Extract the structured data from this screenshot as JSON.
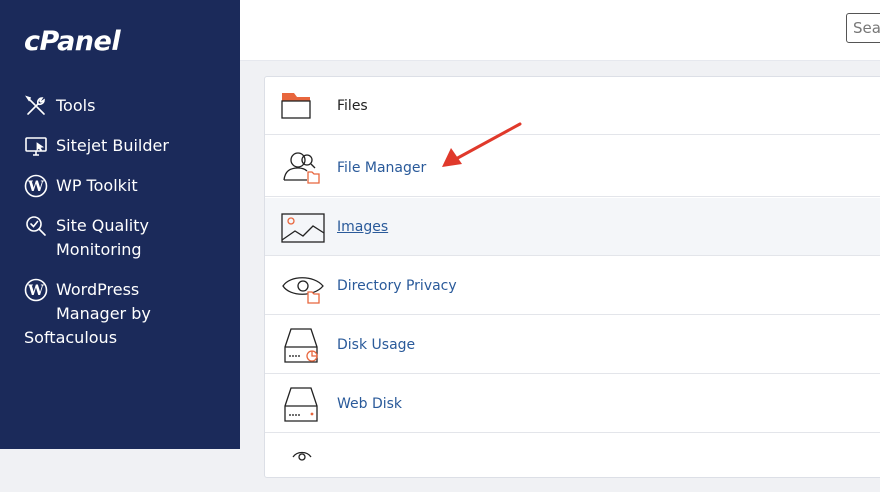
{
  "brand": {
    "logo_text": "cPanel"
  },
  "sidebar": {
    "items": [
      {
        "label": "Tools",
        "icon": "tools-icon"
      },
      {
        "label": "Sitejet Builder",
        "icon": "monitor-icon"
      },
      {
        "label": "WP Toolkit",
        "icon": "wordpress-icon"
      },
      {
        "label_lines": [
          "Site Quality",
          "Monitoring"
        ],
        "icon": "magnifier-check-icon"
      },
      {
        "label_lines": [
          "WordPress",
          "Manager by",
          "Softaculous"
        ],
        "icon": "wordpress-icon"
      }
    ]
  },
  "search": {
    "placeholder": "Search"
  },
  "files_section": {
    "title": "Files",
    "items": [
      {
        "label": "File Manager",
        "icon": "file-manager-icon"
      },
      {
        "label": "Images",
        "icon": "images-icon",
        "state": "hover"
      },
      {
        "label": "Directory Privacy",
        "icon": "eye-folder-icon"
      },
      {
        "label": "Disk Usage",
        "icon": "disk-usage-icon"
      },
      {
        "label": "Web Disk",
        "icon": "web-disk-icon"
      }
    ]
  },
  "colors": {
    "sidebar_bg": "#1b2a5a",
    "accent_orange": "#e8663d",
    "link_blue": "#2a5a9a",
    "annotation_red": "#e0392b"
  },
  "annotation": {
    "type": "arrow",
    "points_to": "File Manager"
  }
}
